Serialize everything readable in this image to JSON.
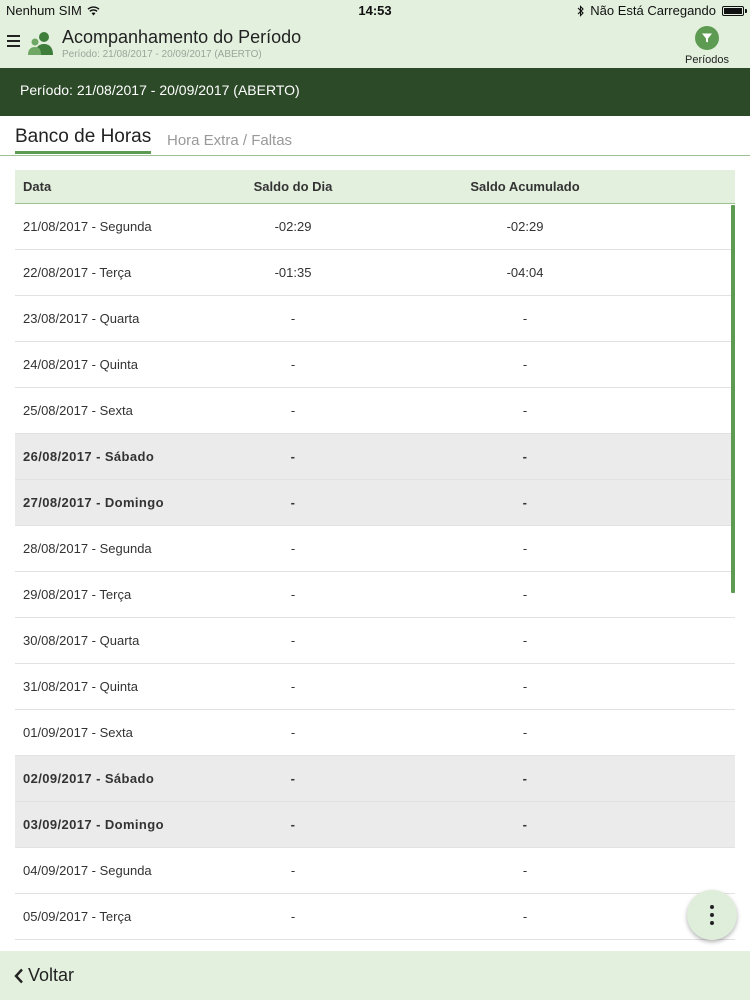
{
  "status_bar": {
    "carrier": "Nenhum SIM",
    "time": "14:53",
    "charging_status": "Não Está Carregando"
  },
  "header": {
    "title": "Acompanhamento do Período",
    "subtitle": "Período: 21/08/2017 - 20/09/2017 (ABERTO)",
    "filter_label": "Períodos"
  },
  "period_banner": "Período: 21/08/2017 - 20/09/2017 (ABERTO)",
  "tabs": [
    {
      "label": "Banco de Horas",
      "active": true
    },
    {
      "label": "Hora Extra / Faltas",
      "active": false
    }
  ],
  "table": {
    "columns": [
      "Data",
      "Saldo do Dia",
      "Saldo Acumulado"
    ],
    "rows": [
      {
        "data": "21/08/2017 - Segunda",
        "saldo_dia": "-02:29",
        "saldo_acumulado": "-02:29",
        "weekend": false
      },
      {
        "data": "22/08/2017 - Terça",
        "saldo_dia": "-01:35",
        "saldo_acumulado": "-04:04",
        "weekend": false
      },
      {
        "data": "23/08/2017 - Quarta",
        "saldo_dia": "-",
        "saldo_acumulado": "-",
        "weekend": false
      },
      {
        "data": "24/08/2017 - Quinta",
        "saldo_dia": "-",
        "saldo_acumulado": "-",
        "weekend": false
      },
      {
        "data": "25/08/2017 - Sexta",
        "saldo_dia": "-",
        "saldo_acumulado": "-",
        "weekend": false
      },
      {
        "data": "26/08/2017 - Sábado",
        "saldo_dia": "-",
        "saldo_acumulado": "-",
        "weekend": true
      },
      {
        "data": "27/08/2017 - Domingo",
        "saldo_dia": "-",
        "saldo_acumulado": "-",
        "weekend": true
      },
      {
        "data": "28/08/2017 - Segunda",
        "saldo_dia": "-",
        "saldo_acumulado": "-",
        "weekend": false
      },
      {
        "data": "29/08/2017 - Terça",
        "saldo_dia": "-",
        "saldo_acumulado": "-",
        "weekend": false
      },
      {
        "data": "30/08/2017 - Quarta",
        "saldo_dia": "-",
        "saldo_acumulado": "-",
        "weekend": false
      },
      {
        "data": "31/08/2017 - Quinta",
        "saldo_dia": "-",
        "saldo_acumulado": "-",
        "weekend": false
      },
      {
        "data": "01/09/2017 - Sexta",
        "saldo_dia": "-",
        "saldo_acumulado": "-",
        "weekend": false
      },
      {
        "data": "02/09/2017 - Sábado",
        "saldo_dia": "-",
        "saldo_acumulado": "-",
        "weekend": true
      },
      {
        "data": "03/09/2017 - Domingo",
        "saldo_dia": "-",
        "saldo_acumulado": "-",
        "weekend": true
      },
      {
        "data": "04/09/2017 - Segunda",
        "saldo_dia": "-",
        "saldo_acumulado": "-",
        "weekend": false
      },
      {
        "data": "05/09/2017 - Terça",
        "saldo_dia": "-",
        "saldo_acumulado": "-",
        "weekend": false
      },
      {
        "data": "",
        "saldo_dia": "",
        "saldo_acumulado": "",
        "weekend": false
      }
    ]
  },
  "footer": {
    "back_label": "Voltar"
  },
  "icons": {
    "menu": "menu-icon",
    "user": "user-group-icon",
    "filter": "filter-icon",
    "fab": "more-vertical-icon",
    "back": "chevron-left-icon",
    "wifi": "wifi-icon",
    "bluetooth": "bluetooth-icon",
    "battery": "battery-icon"
  },
  "colors": {
    "header_bg": "#e3f0de",
    "banner_bg": "#2c4a28",
    "accent": "#5e9b52",
    "weekend_row": "#ebebeb"
  }
}
